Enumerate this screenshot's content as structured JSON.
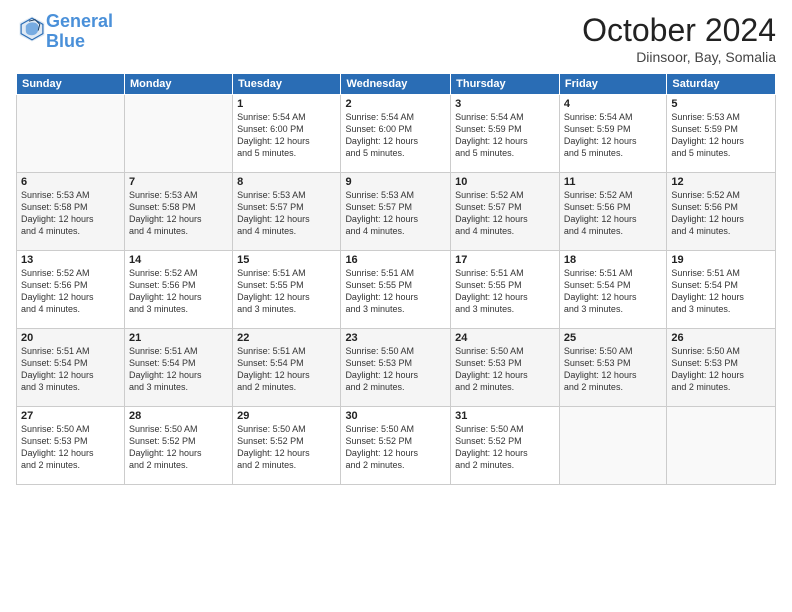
{
  "header": {
    "logo_line1": "General",
    "logo_line2": "Blue",
    "month": "October 2024",
    "location": "Diinsoor, Bay, Somalia"
  },
  "days_of_week": [
    "Sunday",
    "Monday",
    "Tuesday",
    "Wednesday",
    "Thursday",
    "Friday",
    "Saturday"
  ],
  "weeks": [
    [
      {
        "day": "",
        "info": ""
      },
      {
        "day": "",
        "info": ""
      },
      {
        "day": "1",
        "info": "Sunrise: 5:54 AM\nSunset: 6:00 PM\nDaylight: 12 hours\nand 5 minutes."
      },
      {
        "day": "2",
        "info": "Sunrise: 5:54 AM\nSunset: 6:00 PM\nDaylight: 12 hours\nand 5 minutes."
      },
      {
        "day": "3",
        "info": "Sunrise: 5:54 AM\nSunset: 5:59 PM\nDaylight: 12 hours\nand 5 minutes."
      },
      {
        "day": "4",
        "info": "Sunrise: 5:54 AM\nSunset: 5:59 PM\nDaylight: 12 hours\nand 5 minutes."
      },
      {
        "day": "5",
        "info": "Sunrise: 5:53 AM\nSunset: 5:59 PM\nDaylight: 12 hours\nand 5 minutes."
      }
    ],
    [
      {
        "day": "6",
        "info": "Sunrise: 5:53 AM\nSunset: 5:58 PM\nDaylight: 12 hours\nand 4 minutes."
      },
      {
        "day": "7",
        "info": "Sunrise: 5:53 AM\nSunset: 5:58 PM\nDaylight: 12 hours\nand 4 minutes."
      },
      {
        "day": "8",
        "info": "Sunrise: 5:53 AM\nSunset: 5:57 PM\nDaylight: 12 hours\nand 4 minutes."
      },
      {
        "day": "9",
        "info": "Sunrise: 5:53 AM\nSunset: 5:57 PM\nDaylight: 12 hours\nand 4 minutes."
      },
      {
        "day": "10",
        "info": "Sunrise: 5:52 AM\nSunset: 5:57 PM\nDaylight: 12 hours\nand 4 minutes."
      },
      {
        "day": "11",
        "info": "Sunrise: 5:52 AM\nSunset: 5:56 PM\nDaylight: 12 hours\nand 4 minutes."
      },
      {
        "day": "12",
        "info": "Sunrise: 5:52 AM\nSunset: 5:56 PM\nDaylight: 12 hours\nand 4 minutes."
      }
    ],
    [
      {
        "day": "13",
        "info": "Sunrise: 5:52 AM\nSunset: 5:56 PM\nDaylight: 12 hours\nand 4 minutes."
      },
      {
        "day": "14",
        "info": "Sunrise: 5:52 AM\nSunset: 5:56 PM\nDaylight: 12 hours\nand 3 minutes."
      },
      {
        "day": "15",
        "info": "Sunrise: 5:51 AM\nSunset: 5:55 PM\nDaylight: 12 hours\nand 3 minutes."
      },
      {
        "day": "16",
        "info": "Sunrise: 5:51 AM\nSunset: 5:55 PM\nDaylight: 12 hours\nand 3 minutes."
      },
      {
        "day": "17",
        "info": "Sunrise: 5:51 AM\nSunset: 5:55 PM\nDaylight: 12 hours\nand 3 minutes."
      },
      {
        "day": "18",
        "info": "Sunrise: 5:51 AM\nSunset: 5:54 PM\nDaylight: 12 hours\nand 3 minutes."
      },
      {
        "day": "19",
        "info": "Sunrise: 5:51 AM\nSunset: 5:54 PM\nDaylight: 12 hours\nand 3 minutes."
      }
    ],
    [
      {
        "day": "20",
        "info": "Sunrise: 5:51 AM\nSunset: 5:54 PM\nDaylight: 12 hours\nand 3 minutes."
      },
      {
        "day": "21",
        "info": "Sunrise: 5:51 AM\nSunset: 5:54 PM\nDaylight: 12 hours\nand 3 minutes."
      },
      {
        "day": "22",
        "info": "Sunrise: 5:51 AM\nSunset: 5:54 PM\nDaylight: 12 hours\nand 2 minutes."
      },
      {
        "day": "23",
        "info": "Sunrise: 5:50 AM\nSunset: 5:53 PM\nDaylight: 12 hours\nand 2 minutes."
      },
      {
        "day": "24",
        "info": "Sunrise: 5:50 AM\nSunset: 5:53 PM\nDaylight: 12 hours\nand 2 minutes."
      },
      {
        "day": "25",
        "info": "Sunrise: 5:50 AM\nSunset: 5:53 PM\nDaylight: 12 hours\nand 2 minutes."
      },
      {
        "day": "26",
        "info": "Sunrise: 5:50 AM\nSunset: 5:53 PM\nDaylight: 12 hours\nand 2 minutes."
      }
    ],
    [
      {
        "day": "27",
        "info": "Sunrise: 5:50 AM\nSunset: 5:53 PM\nDaylight: 12 hours\nand 2 minutes."
      },
      {
        "day": "28",
        "info": "Sunrise: 5:50 AM\nSunset: 5:52 PM\nDaylight: 12 hours\nand 2 minutes."
      },
      {
        "day": "29",
        "info": "Sunrise: 5:50 AM\nSunset: 5:52 PM\nDaylight: 12 hours\nand 2 minutes."
      },
      {
        "day": "30",
        "info": "Sunrise: 5:50 AM\nSunset: 5:52 PM\nDaylight: 12 hours\nand 2 minutes."
      },
      {
        "day": "31",
        "info": "Sunrise: 5:50 AM\nSunset: 5:52 PM\nDaylight: 12 hours\nand 2 minutes."
      },
      {
        "day": "",
        "info": ""
      },
      {
        "day": "",
        "info": ""
      }
    ]
  ]
}
